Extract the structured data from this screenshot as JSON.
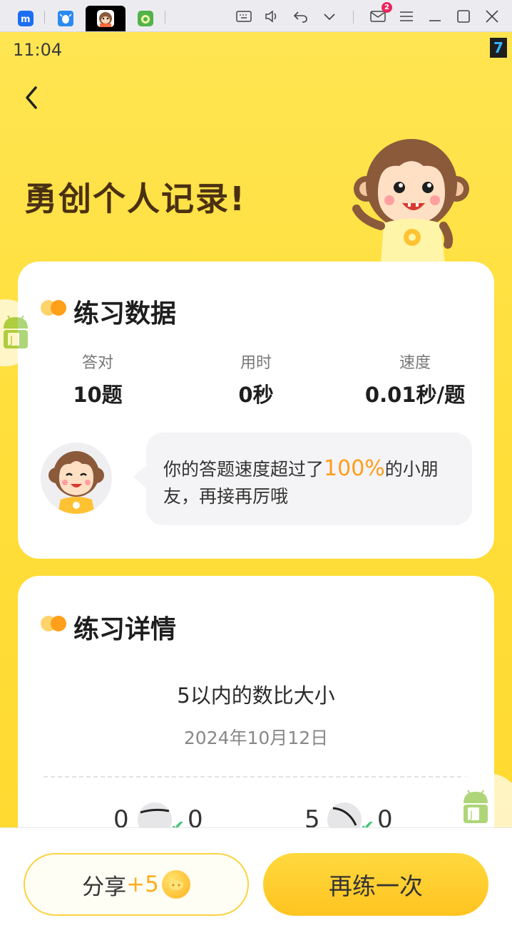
{
  "emulator": {
    "tabs": [
      {
        "name": "app-tab-m",
        "color": "#1d6ff2"
      },
      {
        "name": "app-tab-bug",
        "color": "#2b8af2"
      },
      {
        "name": "app-tab-monkey",
        "color": "#ff6b3d"
      },
      {
        "name": "app-tab-green",
        "color": "#52b34a"
      }
    ],
    "mail_badge": "2"
  },
  "status_bar": {
    "time": "11:04",
    "indicator": "7"
  },
  "hero": {
    "title": "勇创个人记录!"
  },
  "practice_data": {
    "title": "练习数据",
    "stats": [
      {
        "label": "答对",
        "value": "10题"
      },
      {
        "label": "用时",
        "value": "0秒"
      },
      {
        "label": "速度",
        "value": "0.01秒/题"
      }
    ],
    "message_before": "你的答题速度超过了",
    "message_highlight": "100%",
    "message_after": "的小朋友，再接再厉哦"
  },
  "practice_detail": {
    "title": "练习详情",
    "exercise_name": "5以内的数比大小",
    "date": "2024年10月12日",
    "questions": [
      {
        "left": "0",
        "right": "0"
      },
      {
        "left": "5",
        "right": "0"
      }
    ]
  },
  "actions": {
    "share_label": "分享",
    "share_reward": "+5",
    "again_label": "再练一次"
  },
  "colors": {
    "accent": "#ffd92e",
    "highlight": "#ff9d19",
    "title_brown": "#4a3013"
  }
}
